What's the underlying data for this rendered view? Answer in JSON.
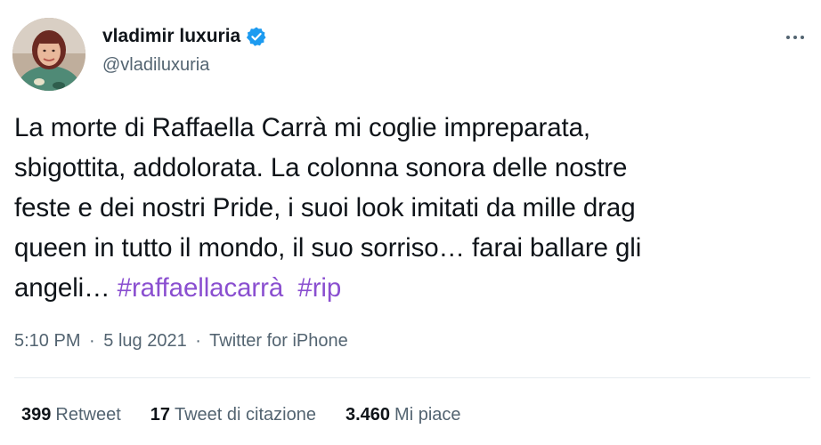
{
  "user": {
    "display_name": "vladimir luxuria",
    "handle": "@vladiluxuria",
    "verified_icon": "verified-badge-icon",
    "accent_color": "#1d9bf0"
  },
  "menu": {
    "more_icon": "more-options-icon"
  },
  "tweet": {
    "lines": [
      "La morte di Raffaella Carrà mi coglie impreparata,",
      "sbigottita, addolorata. La colonna sonora delle nostre",
      "feste e dei nostri Pride, i suoi look imitati da mille drag",
      "queen in tutto il mondo, il suo sorriso… farai ballare gli",
      "angeli… "
    ],
    "hashtags": [
      "#raffaellacarrà",
      "#rip"
    ],
    "hashtag_color": "#8a4fd0"
  },
  "meta": {
    "time": "5:10 PM",
    "separator": "·",
    "date": "5 lug 2021",
    "source": "Twitter for iPhone"
  },
  "stats": {
    "retweets": {
      "count": "399",
      "label": "Retweet"
    },
    "quotes": {
      "count": "17",
      "label": "Tweet di citazione"
    },
    "likes": {
      "count": "3.460",
      "label": "Mi piace"
    }
  }
}
